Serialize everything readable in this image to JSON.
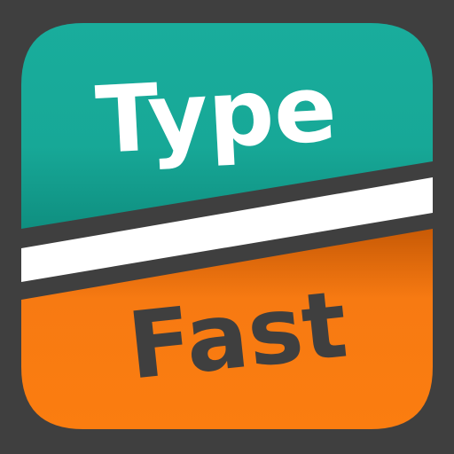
{
  "logo": {
    "top_word": "Type",
    "bottom_word": "Fast",
    "colors": {
      "background": "#3f3f3f",
      "top_panel": "#17a897",
      "top_panel_shade": "#0f8f80",
      "bottom_panel": "#f77a12",
      "bottom_panel_shade": "#c85a06",
      "divider": "#ffffff",
      "top_text": "#ffffff",
      "bottom_text": "#3f3f3f"
    }
  }
}
